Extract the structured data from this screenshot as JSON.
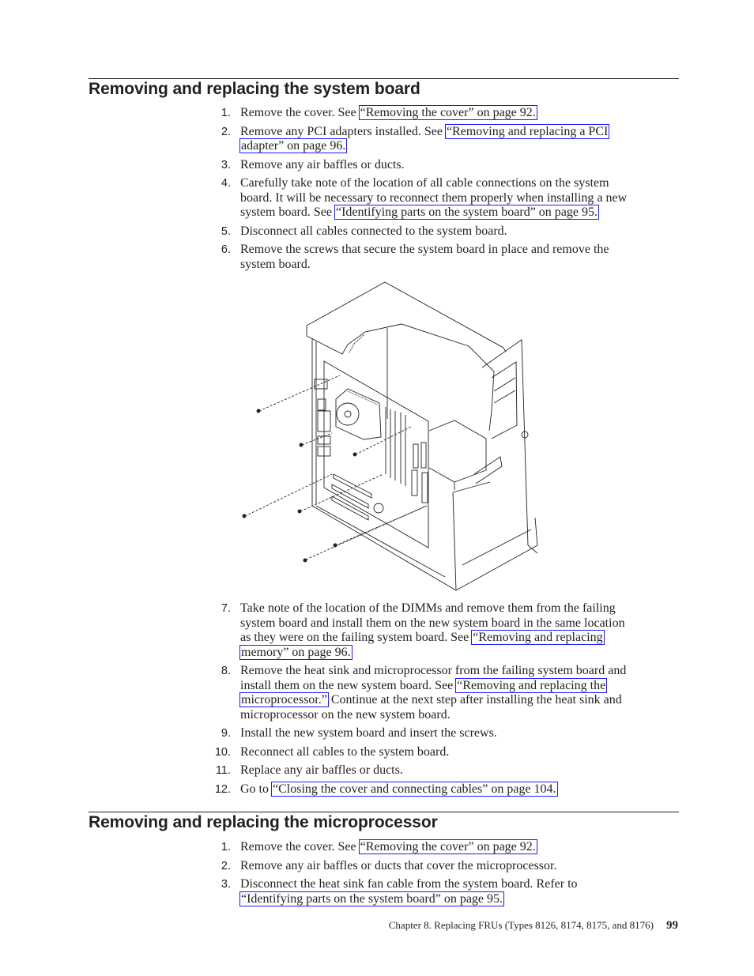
{
  "section1": {
    "title": "Removing and replacing the system board",
    "steps_a": [
      {
        "num": "1.",
        "lines": [
          [
            {
              "t": "Remove the cover. See "
            },
            {
              "t": "“Removing the cover” on page 92.",
              "link": true
            }
          ]
        ]
      },
      {
        "num": "2.",
        "lines": [
          [
            {
              "t": "Remove any PCI adapters installed. See "
            },
            {
              "t": "“Removing and replacing a PCI",
              "link": true
            }
          ],
          [
            {
              "t": "adapter” on page 96.",
              "link": true
            }
          ]
        ]
      },
      {
        "num": "3.",
        "lines": [
          [
            {
              "t": "Remove any air baffles or ducts."
            }
          ]
        ]
      },
      {
        "num": "4.",
        "lines": [
          [
            {
              "t": "Carefully take note of the location of all cable connections on the system"
            }
          ],
          [
            {
              "t": "board. It will be necessary to reconnect them properly when installing a new"
            }
          ],
          [
            {
              "t": "system board. See "
            },
            {
              "t": "“Identifying parts on the system board” on page 95.",
              "link": true
            }
          ]
        ]
      },
      {
        "num": "5.",
        "lines": [
          [
            {
              "t": "Disconnect all cables connected to the system board."
            }
          ]
        ]
      },
      {
        "num": "6.",
        "lines": [
          [
            {
              "t": "Remove the screws that secure the system board in place and remove the"
            }
          ],
          [
            {
              "t": "system board."
            }
          ]
        ]
      }
    ],
    "steps_b": [
      {
        "num": "7.",
        "lines": [
          [
            {
              "t": "Take note of the location of the DIMMs and remove them from the failing"
            }
          ],
          [
            {
              "t": "system board and install them on the new system board in the same location"
            }
          ],
          [
            {
              "t": "as they were on the failing system board. See "
            },
            {
              "t": "“Removing and replacing",
              "link": true
            }
          ],
          [
            {
              "t": "memory” on page 96.",
              "link": true
            }
          ]
        ]
      },
      {
        "num": "8.",
        "lines": [
          [
            {
              "t": "Remove the heat sink and microprocessor from the failing system board and"
            }
          ],
          [
            {
              "t": "install them on the new system board. See "
            },
            {
              "t": "“Removing and replacing the",
              "link": true
            }
          ],
          [
            {
              "t": "microprocessor.”",
              "link": true
            },
            {
              "t": " Continue at the next step after installing the heat sink and"
            }
          ],
          [
            {
              "t": "microprocessor on the new system board."
            }
          ]
        ]
      },
      {
        "num": "9.",
        "lines": [
          [
            {
              "t": "Install the new system board and insert the screws."
            }
          ]
        ]
      },
      {
        "num": "10.",
        "lines": [
          [
            {
              "t": "Reconnect all cables to the system board."
            }
          ]
        ]
      },
      {
        "num": "11.",
        "lines": [
          [
            {
              "t": "Replace any air baffles or ducts."
            }
          ]
        ]
      },
      {
        "num": "12.",
        "lines": [
          [
            {
              "t": "Go to "
            },
            {
              "t": "“Closing the cover and connecting cables” on page 104.",
              "link": true
            }
          ]
        ]
      }
    ]
  },
  "section2": {
    "title": "Removing and replacing the microprocessor",
    "steps": [
      {
        "num": "1.",
        "lines": [
          [
            {
              "t": "Remove the cover. See "
            },
            {
              "t": "“Removing the cover” on page 92.",
              "link": true
            }
          ]
        ]
      },
      {
        "num": "2.",
        "lines": [
          [
            {
              "t": "Remove any air baffles or ducts that cover the microprocessor."
            }
          ]
        ]
      },
      {
        "num": "3.",
        "lines": [
          [
            {
              "t": "Disconnect the heat sink fan cable from the system board. Refer to"
            }
          ],
          [
            {
              "t": "“Identifying parts on the system board” on page 95.",
              "link": true
            }
          ]
        ]
      }
    ]
  },
  "figure": {
    "icon": "computer-tower-system-board-removal-illustration"
  },
  "footer": {
    "chapter": "Chapter 8. Replacing FRUs (Types 8126, 8174, 8175, and 8176)",
    "page": "99"
  },
  "colors": {
    "link_border": "#1a1aff",
    "text": "#231f20"
  }
}
